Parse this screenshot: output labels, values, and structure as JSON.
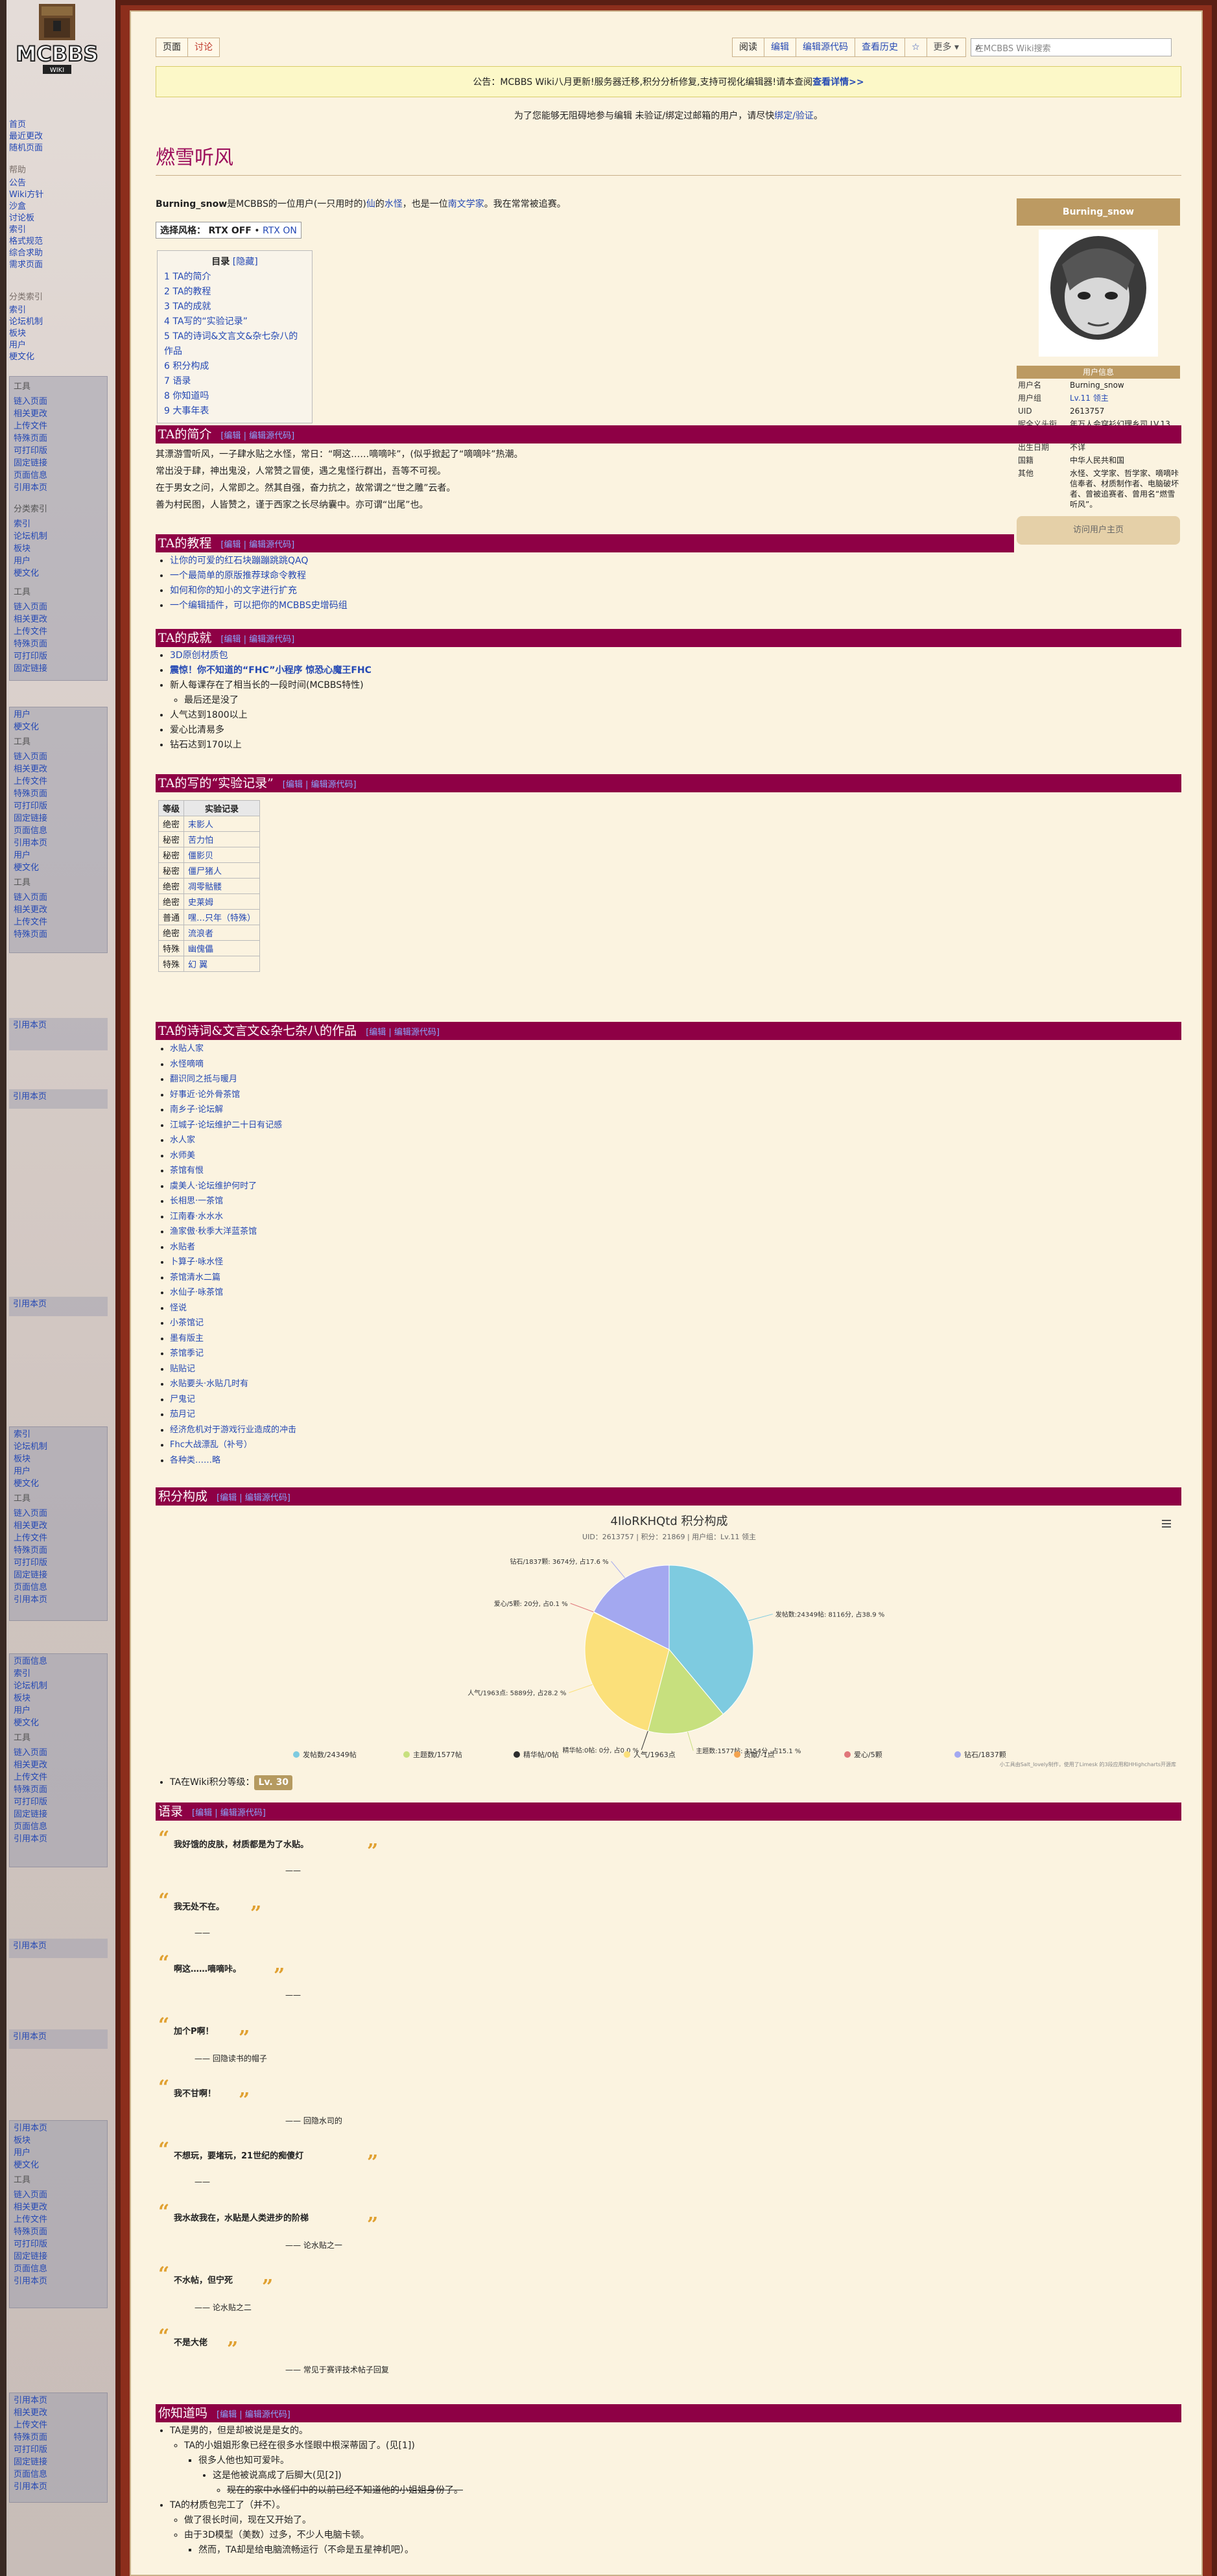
{
  "sidebar": {
    "logo_text": "MCBBS",
    "logo_sub": "WIKI",
    "nav": [
      "首页",
      "最近更改",
      "随机页面"
    ],
    "help_title": "帮助",
    "help": [
      "公告",
      "Wiki方针",
      "沙盒",
      "讨论板",
      "索引",
      "格式规范",
      "综合求助",
      "需求页面"
    ],
    "cat_title": "分类索引",
    "cats": [
      "索引",
      "论坛机制",
      "板块",
      "用户",
      "梗文化"
    ],
    "tools_title": "工具",
    "tools": [
      "链入页面",
      "相关更改",
      "上传文件",
      "特殊页面",
      "可打印版",
      "固定链接",
      "页面信息",
      "引用本页"
    ]
  },
  "tabs": {
    "page": "页面",
    "talk": "讨论",
    "read": "阅读",
    "edit": "编辑",
    "edit_source": "编辑源代码",
    "history": "查看历史",
    "more": "更多",
    "search_placeholder": "在MCBBS Wiki搜索"
  },
  "notice": {
    "text": "公告：MCBBS Wiki八月更新!服务器迁移,积分分析修复,支持可视化编辑器!请本查阅",
    "link": "查看详情>>"
  },
  "subnotice": {
    "text": "为了您能够无阻碍地参与编辑 未验证/绑定过邮箱的用户，请尽快",
    "link": "绑定/验证"
  },
  "page": {
    "title": "燃雪听风",
    "intro_name": "Burning_snow",
    "intro_mid": "是MCBBS的一位用户(一只用时的)",
    "intro_link1": "仙",
    "intro_mid2": "的",
    "intro_link2": "水怪",
    "intro_mid3": "，也是一位",
    "intro_link3": "南文学家",
    "intro_end": "。我在常常被追赛。",
    "rtx_label": "选择风格：",
    "rtx_off": "RTX OFF",
    "rtx_on": "RTX ON"
  },
  "toc": {
    "title": "目录",
    "hide": "[隐藏]",
    "items": [
      "1 TA的简介",
      "2 TA的教程",
      "3 TA的成就",
      "4 TA写的“实验记录”",
      "5 TA的诗词&文言文&杂七杂八的作品",
      "6 积分构成",
      "7 语录",
      "8 你知道吗",
      "9 大事年表"
    ]
  },
  "sections": {
    "intro": "TA的简介",
    "tutorial": "TA的教程",
    "achieve": "TA的成就",
    "exp": "TA的写的“实验记录”",
    "works": "TA的诗词&文言文&杂七杂八的作品",
    "points": "积分构成",
    "quotes": "语录",
    "dyk": "你知道吗",
    "edit_link": "[编辑 | 编辑源代码]"
  },
  "intro_lines": [
    "其漂游雪听风，一子肆水贴之水怪，常日：“啊这……嘀嘀咔”，(似乎掀起了“嘀嘀咔”热潮。",
    "常出没于肆，神出鬼没，人常赞之冒使，遇之鬼怪行群出，吾等不可视。",
    "在于男女之问，人常即之。然其自强，奋力抗之，故常谓之“世之雕”云者。",
    "善为村民图，人皆赞之，谨于西家之长尽纳囊中。亦可谓“岀尾”也。"
  ],
  "tutorials": [
    "让你的可爱的红石块蹦蹦跳跳QAQ",
    "一个最简单的原版推荐球命令教程",
    "如何和你的知小的文字进行扩充",
    "一个编辑插件，可以把你的MCBBS史增码组"
  ],
  "achievements": [
    "3D原创材质包",
    "震惊！你不知道的“FHC”小程序 惊恐心魔王FHC",
    "新人每课存在了相当长的一段时间(MCBBS特性)",
    "最后还是没了",
    "人气达到1800以上",
    "爱心比清易多",
    "钻石达到170以上"
  ],
  "exp_table": {
    "headers": [
      "等级",
      "实验记录"
    ],
    "rows": [
      [
        "绝密",
        "末影人"
      ],
      [
        "秘密",
        "苦力怕"
      ],
      [
        "秘密",
        "僵影贝"
      ],
      [
        "秘密",
        "僵尸猪人"
      ],
      [
        "绝密",
        "凋零骷髅"
      ],
      [
        "绝密",
        "史莱姆"
      ],
      [
        "普通",
        "嘿…只年（特殊）"
      ],
      [
        "绝密",
        "流浪者"
      ],
      [
        "特殊",
        "幽傀儡"
      ],
      [
        "特殊",
        "幻 翼"
      ]
    ]
  },
  "works": [
    "水贴人家",
    "水怪嘀嘀",
    "翻识同之抵与暖月",
    "好事近·论外骨茶馆",
    "南乡子·论坛解",
    "江城子·论坛维护二十日有记感",
    "水人家",
    "水师美",
    "茶馆有恨",
    "虞美人·论坛维护何时了",
    "长相思·一茶馆",
    "江南春·水水水",
    "渔家傲·秋季大洋蓝茶馆",
    "水贴者",
    "卜算子·咏水怪",
    "茶馆清水二篇",
    "水仙子·咏茶馆",
    "怪说",
    "小茶馆记",
    "墨有版主",
    "茶馆季记",
    "贴贴记",
    "水贴要头·水贴几时有",
    "尸鬼记",
    "茄月记",
    "经济危机对于游戏行业造成的冲击",
    "Fhc大战漂乱（补号）",
    "各种类……略"
  ],
  "chart_data": {
    "type": "pie",
    "title": "4IloRKHQtd 积分构成",
    "subtitle": "UID：2613757 | 积分：21869 | 用户组：Lv.11 领主",
    "labels": [
      "发贴数",
      "主题数",
      "精华帖",
      "人气",
      "贡献",
      "爱心",
      "钻石"
    ],
    "values": [
      8116,
      3154,
      0,
      5889,
      0,
      20,
      3674
    ],
    "display_labels": [
      "发帖数:24349帖: 8116分, 占38.9 %",
      "主题数:1577帖: 3154分, 占15.1 %",
      "精华帖:0帖: 0分, 占0.0 %",
      "人气/1963点: 5889分, 占28.2 %",
      "贡献/-1点",
      "爱心/5颗: 20分, 占0.1 %",
      "钻石/1837颗: 3674分, 占17.6 %"
    ],
    "legend": [
      "发帖数/24349帖",
      "主题数/1577帖",
      "精华帖/0帖",
      "人气/1963点",
      "贡献/-1点",
      "爱心/5颗",
      "钻石/1837颗"
    ],
    "colors": [
      "#7ecbe0",
      "#c7e07e",
      "#2d2d2d",
      "#fbe07a",
      "#f3a34f",
      "#e0767a",
      "#a3a8f0"
    ],
    "credit": "小工具由Salt_lovely制作，使用了Limesk 的3段应用和HHighcharts开源库"
  },
  "level_line": {
    "text": "TA在Wiki积分等级：",
    "badge": "Lv. 30"
  },
  "quotes": [
    {
      "text": "我好饿的皮肤，材质都是为了水贴。",
      "by": "——"
    },
    {
      "text": "我无处不在。",
      "by": "——"
    },
    {
      "text": "啊这……嘀嘀咔。",
      "by": "——"
    },
    {
      "text": "加个P啊！",
      "by": "—— 回隐读书的帽子"
    },
    {
      "text": "我不甘啊！",
      "by": "—— 回隐水司的"
    },
    {
      "text": "不想玩，要堵玩，21世纪的痴傻灯",
      "by": "——"
    },
    {
      "text": "我水故我在，水贴是人类进步的阶梯",
      "by": "—— 论水贴之一"
    },
    {
      "text": "不水帖，但宁死",
      "by": "—— 论水贴之二"
    },
    {
      "text": "不是大佬",
      "by": "—— 常见于赛评技术帖子回复"
    }
  ],
  "dyk": [
    "TA是男的，但是却被说是是女的。",
    "TA的小姐姐形象已经在很多水怪眼中根深蒂固了。(见[1])",
    "很多人他也知可爱咔。",
    "这是他被说高成了后脚大(见[2])",
    "现在的家中水怪们中的以前已经不知道他的小姐姐身份了。",
    "TA的材质包完工了（并不）。",
    "做了很长时间，现在又开始了。",
    "由于3D模型（美数）过多，不少人电脑卡顿。",
    "然而，TA却是给电脑流畅运行（不命是五星神机吧）。"
  ],
  "infobox": {
    "name": "Burning_snow",
    "section": "用户信息",
    "rows": [
      [
        "用户名",
        "Burning_snow"
      ],
      [
        "用户组",
        "Lv.11 领主"
      ],
      [
        "UID",
        "2613757"
      ],
      [
        "昵全义头衔",
        "年万人会穿衫幻理乡司 LV.13 嘀嘀咔"
      ],
      [
        "出生日期",
        "不详"
      ],
      [
        "国籍",
        "中华人民共和国"
      ],
      [
        "其他",
        "水怪、文学家、哲学家、嘀嘀咔信奉者、材质制作者、电脑破坏者、曾被追赛者、曾用名“燃雪听风”。"
      ]
    ],
    "button": "访问用户主页"
  }
}
